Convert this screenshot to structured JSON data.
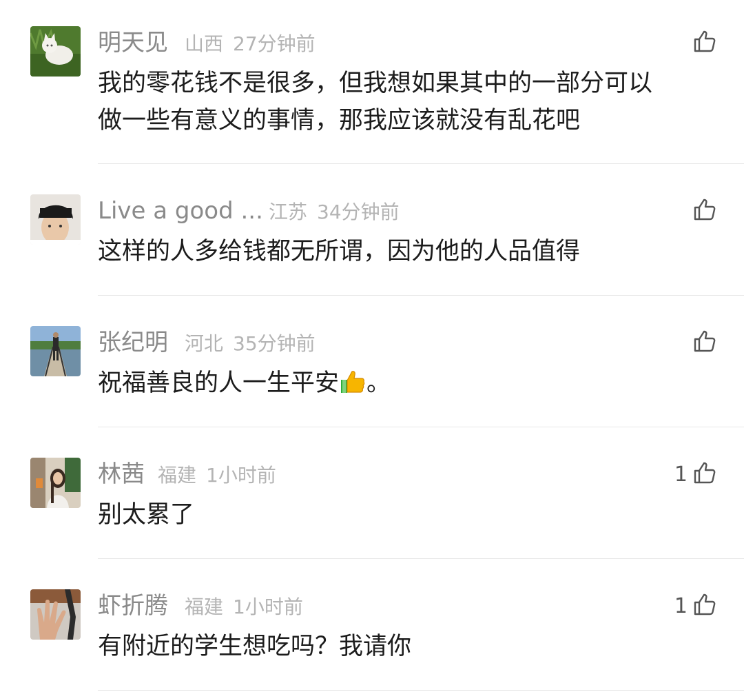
{
  "comments": [
    {
      "username": "明天见",
      "location": "山西",
      "time": "27分钟前",
      "text_lines": [
        "我的零花钱不是很多，但我想如果其中的一部分可以",
        "做一些有意义的事情，那我应该就没有乱花吧"
      ],
      "likes": "",
      "avatar": "cat-on-grass-avatar"
    },
    {
      "username": "Live a good ...",
      "location": "江苏",
      "time": "34分钟前",
      "text_lines": [
        "这样的人多给钱都无所谓，因为他的人品值得"
      ],
      "likes": "",
      "avatar": "young-man-portrait-avatar"
    },
    {
      "username": "张纪明",
      "location": "河北",
      "time": "35分钟前",
      "text_lines": [
        "祝福善良的人一生平安",
        "。"
      ],
      "likes": "",
      "avatar": "man-on-boardwalk-avatar"
    },
    {
      "username": "林茜",
      "location": "福建",
      "time": "1小时前",
      "text_lines": [
        "别太累了"
      ],
      "likes": "1",
      "avatar": "woman-portrait-avatar"
    },
    {
      "username": "虾折腾",
      "location": "福建",
      "time": "1小时前",
      "text_lines": [
        "有附近的学生想吃吗？我请你"
      ],
      "likes": "1",
      "avatar": "hand-gesture-avatar"
    }
  ],
  "icons": {
    "like": "thumbs-up-outline-icon",
    "emoji": "thumbs-up-emoji"
  },
  "colors": {
    "username": "#8a8a8a",
    "meta": "#b4b4b4",
    "text": "#1c1c1c",
    "divider": "#e6e6e6"
  }
}
